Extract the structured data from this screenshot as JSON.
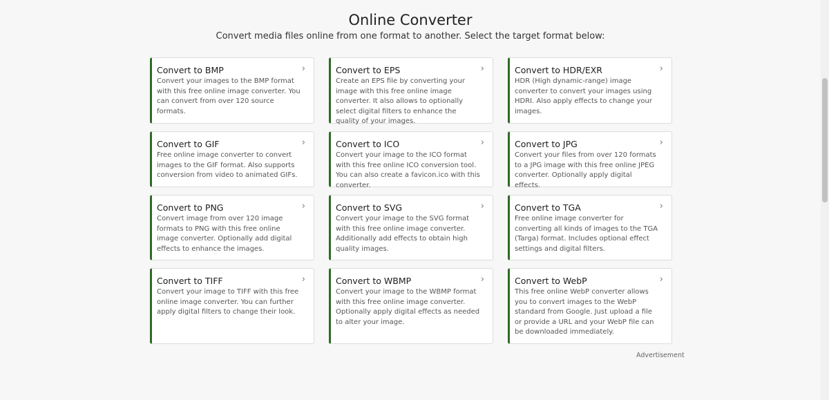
{
  "header": {
    "title": "Online Converter",
    "subtitle": "Convert media files online from one format to another. Select the target format below:"
  },
  "cards": [
    {
      "title": "Convert to BMP",
      "desc": "Convert your images to the BMP format with this free online image converter. You can convert from over 120 source formats."
    },
    {
      "title": "Convert to EPS",
      "desc": "Create an EPS file by converting your image with this free online image converter. It also allows to optionally select digital filters to enhance the quality of your images."
    },
    {
      "title": "Convert to HDR/EXR",
      "desc": "HDR (High dynamic-range) image converter to convert your images using HDRI. Also apply effects to change your images."
    },
    {
      "title": "Convert to GIF",
      "desc": "Free online image converter to convert images to the GIF format. Also supports conversion from video to animated GIFs."
    },
    {
      "title": "Convert to ICO",
      "desc": "Convert your image to the ICO format with this free online ICO conversion tool. You can also create a favicon.ico with this converter."
    },
    {
      "title": "Convert to JPG",
      "desc": "Convert your files from over 120 formats to a JPG image with this free online JPEG converter. Optionally apply digital effects."
    },
    {
      "title": "Convert to PNG",
      "desc": "Convert image from over 120 image formats to PNG with this free online image converter. Optionally add digital effects to enhance the images."
    },
    {
      "title": "Convert to SVG",
      "desc": "Convert your image to the SVG format with this free online image converter. Additionally add effects to obtain high quality images."
    },
    {
      "title": "Convert to TGA",
      "desc": "Free online image converter for converting all kinds of images to the TGA (Targa) format. Includes optional effect settings and digital filters."
    },
    {
      "title": "Convert to TIFF",
      "desc": "Convert your image to TIFF with this free online image converter. You can further apply digital filters to change their look."
    },
    {
      "title": "Convert to WBMP",
      "desc": "Convert your image to the WBMP format with this free online image converter. Optionally apply digital effects as needed to alter your image."
    },
    {
      "title": "Convert to WebP",
      "desc": "This free online WebP converter allows you to convert images to the WebP standard from Google. Just upload a file or provide a URL and your WebP file can be downloaded immediately."
    }
  ],
  "icons": {
    "card_arrow": "chevron-right-icon"
  },
  "ad_label": "Advertisement",
  "colors": {
    "accent": "#2e6b25"
  }
}
